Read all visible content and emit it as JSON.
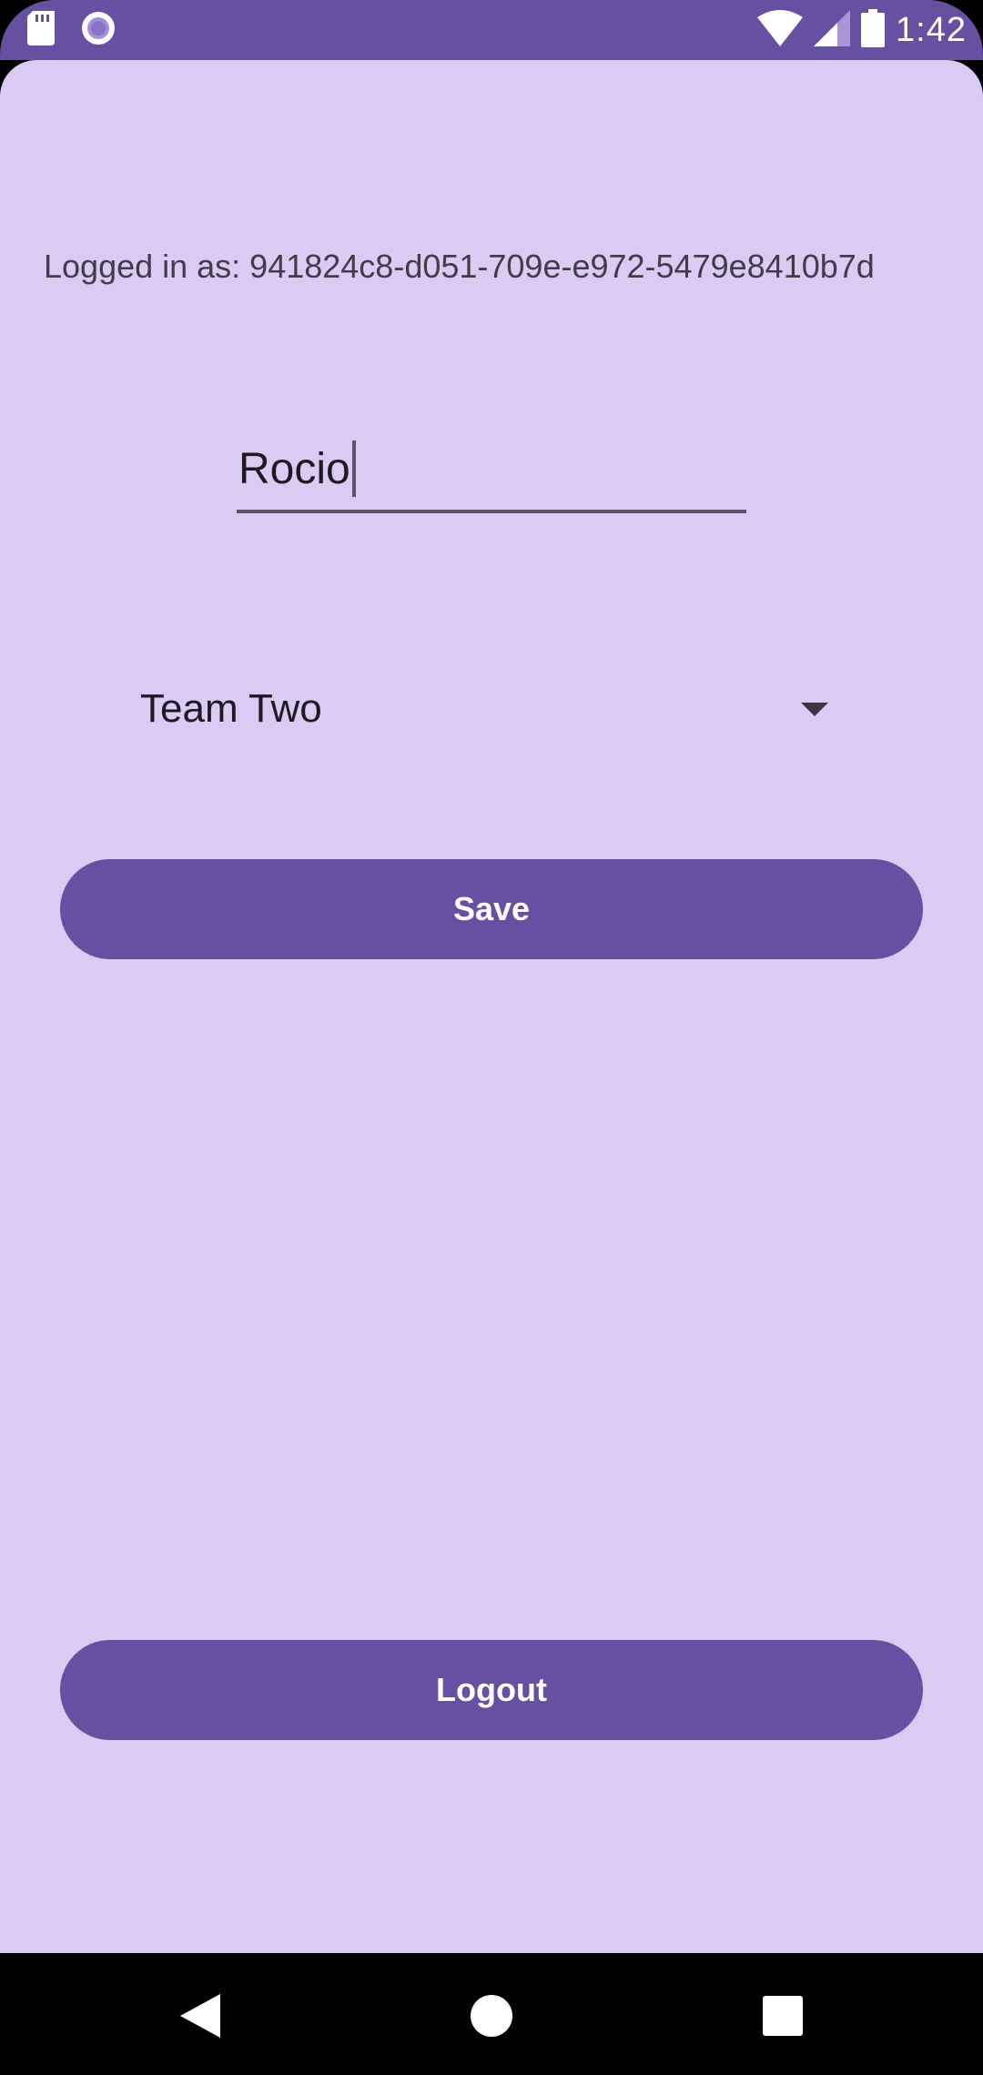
{
  "status_bar": {
    "time": "1:42",
    "left_icons": [
      "sd-card-icon",
      "record-icon"
    ],
    "right_icons": [
      "wifi-icon",
      "cell-signal-icon",
      "battery-icon"
    ]
  },
  "user": {
    "logged_in_text": "Logged in as: 941824c8-d051-709e-e972-5479e8410b7d"
  },
  "name_field": {
    "value": "Rocio"
  },
  "team_dropdown": {
    "selected": "Team Two"
  },
  "buttons": {
    "save_label": "Save",
    "logout_label": "Logout"
  },
  "nav_bar": {
    "icons": [
      "back-icon",
      "home-icon",
      "recents-icon"
    ]
  },
  "colors": {
    "primary": "#674fa2",
    "background": "#dbcbf4",
    "on_primary": "#ffffff",
    "text": "#1d1a22"
  }
}
